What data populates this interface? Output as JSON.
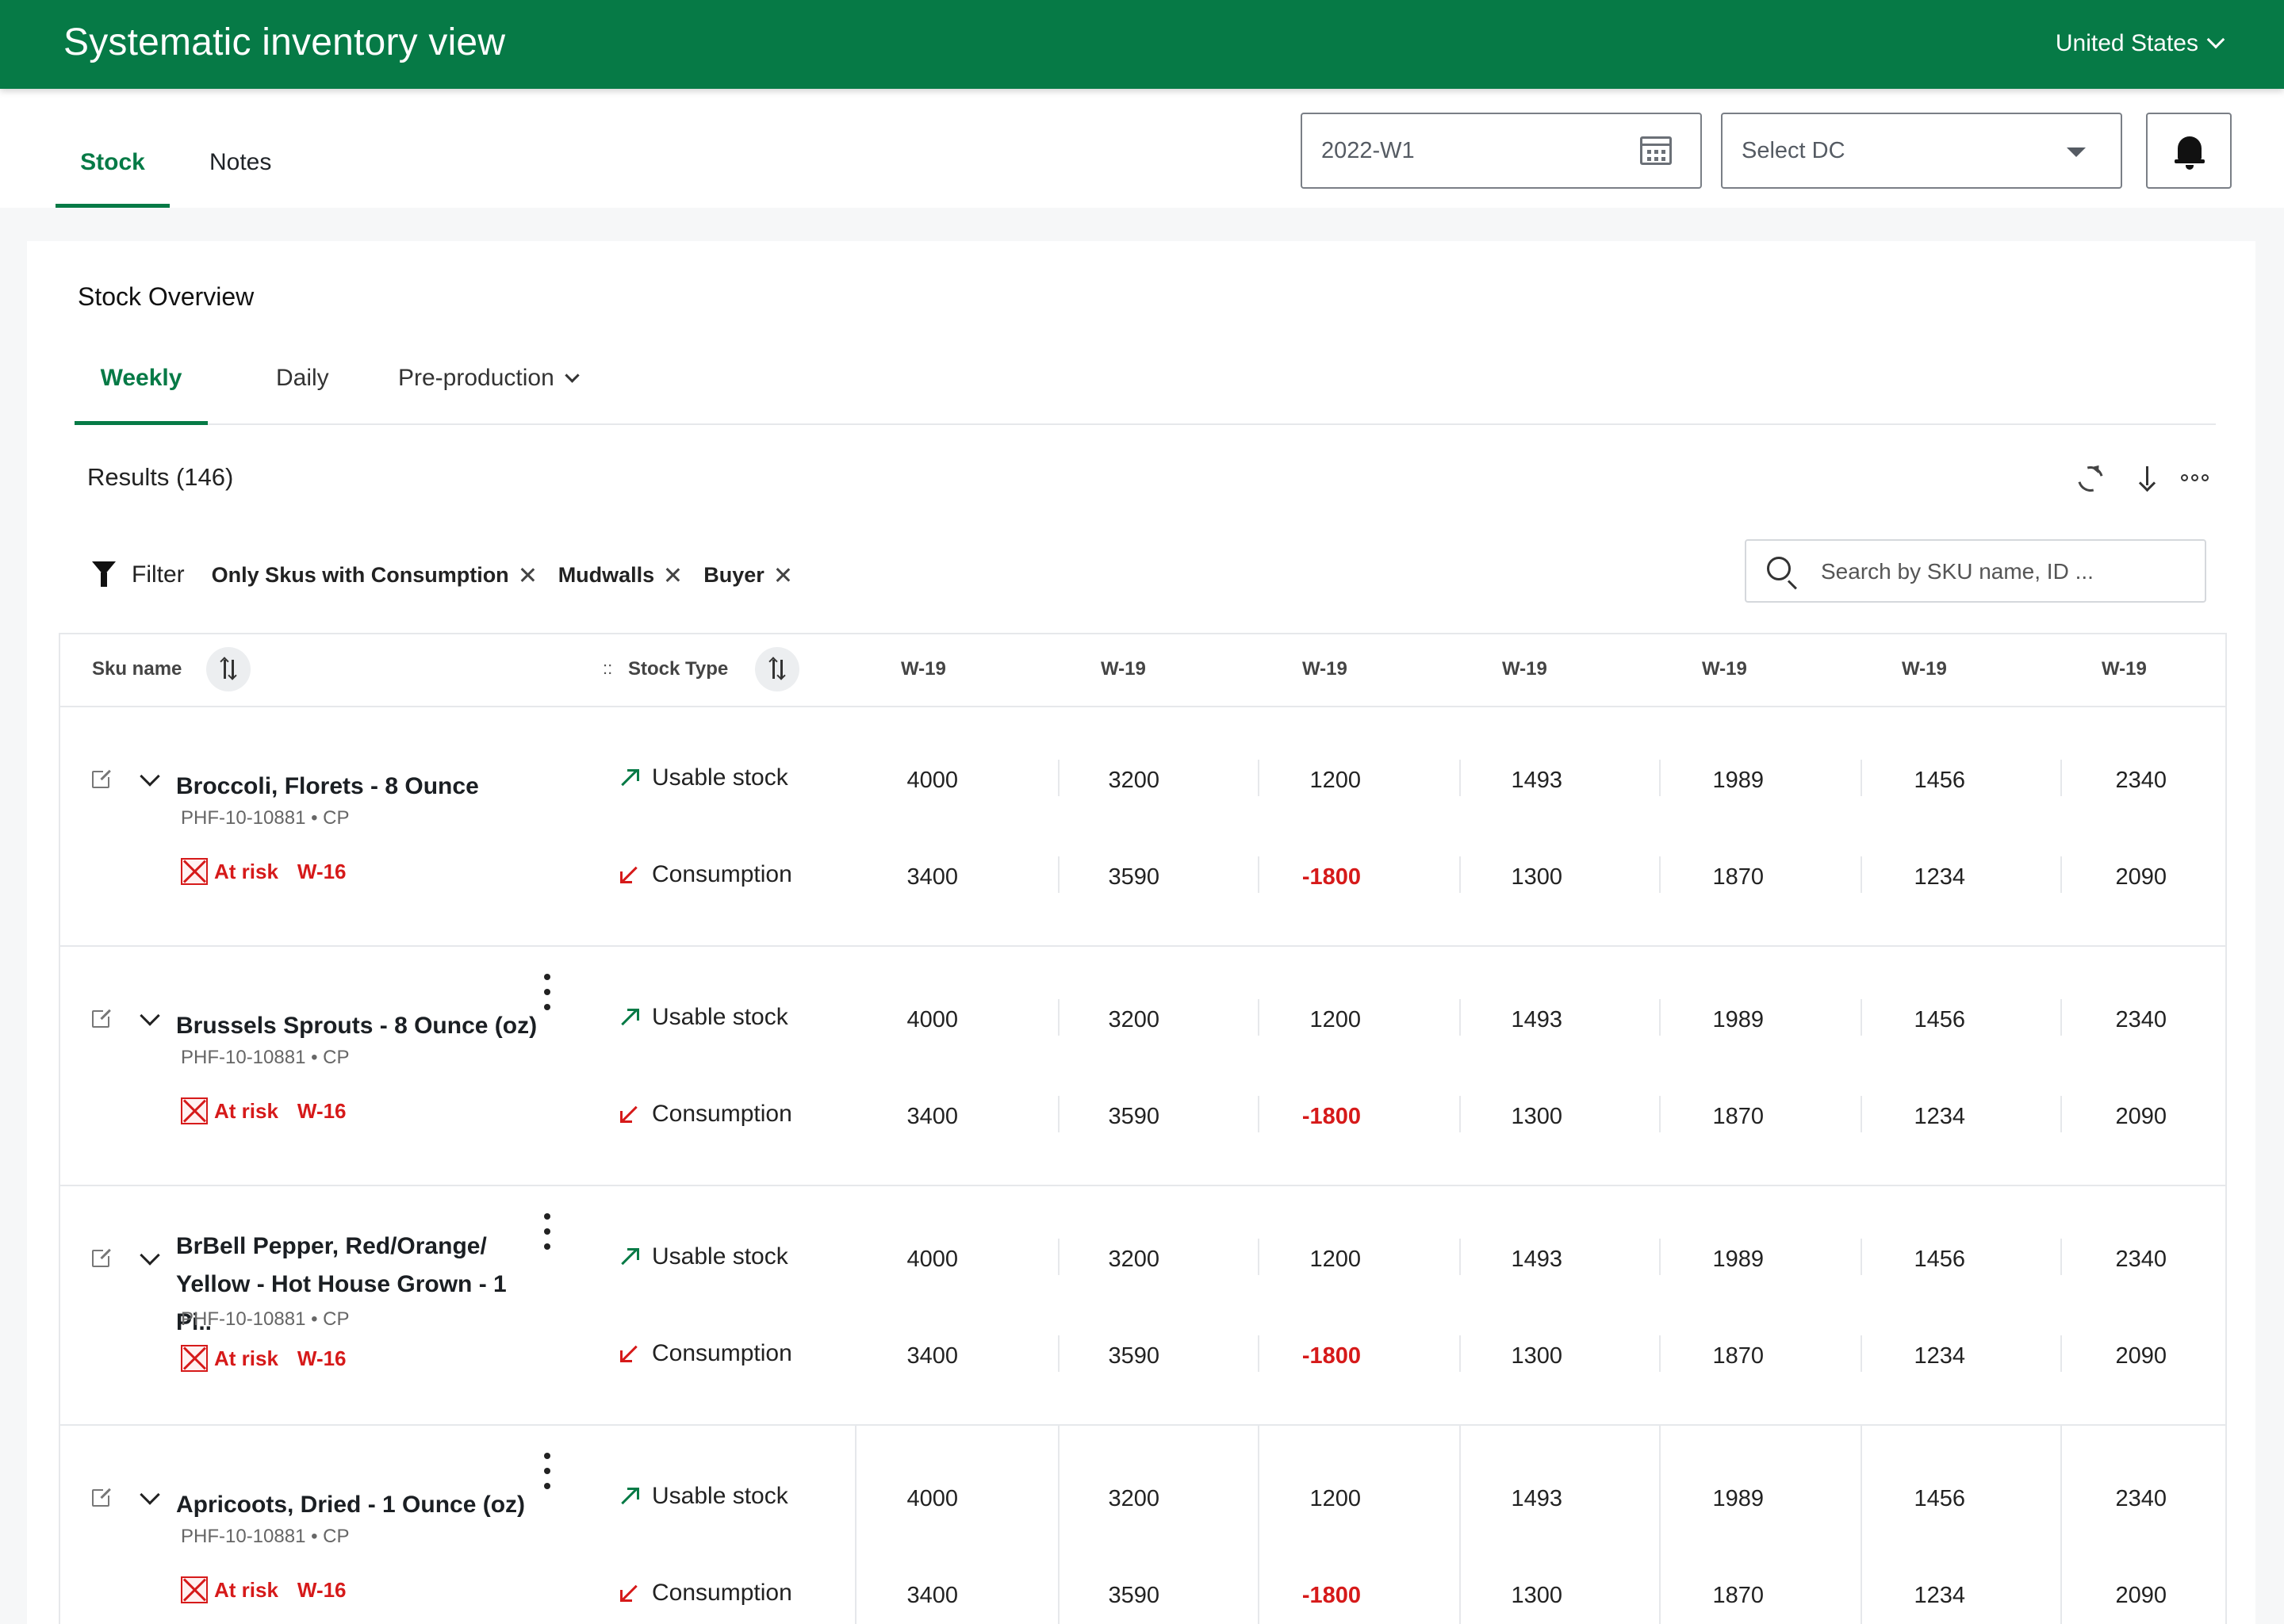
{
  "header": {
    "title": "Systematic inventory view",
    "country": "United States"
  },
  "subnav": {
    "tabs": [
      "Stock",
      "Notes"
    ],
    "active_tab": "Stock",
    "week": "2022-W1",
    "dc_placeholder": "Select DC"
  },
  "overview": {
    "title": "Stock Overview",
    "tabs": [
      "Weekly",
      "Daily",
      "Pre-production"
    ],
    "active_tab": "Weekly",
    "results_label": "Results (146)",
    "filter_label": "Filter",
    "chips": [
      "Only Skus with Consumption",
      "Mudwalls",
      "Buyer"
    ],
    "search_placeholder": "Search by SKU name, ID ..."
  },
  "table": {
    "col_sku": "Sku name",
    "col_stock_type": "Stock Type",
    "drag_handle": "::",
    "weeks": [
      "W-19",
      "W-19",
      "W-19",
      "W-19",
      "W-19",
      "W-19",
      "W-19"
    ],
    "stock_types": [
      "Usable stock",
      "Consumption"
    ],
    "rows": [
      {
        "name_lines": [
          "Broccoli, Florets - 8 Ounce",
          ""
        ],
        "id": "PHF-10-10881 • CP",
        "risk": "At risk",
        "risk_week": "W-16",
        "usable": [
          "4000",
          "3200",
          "1200",
          "1493",
          "1989",
          "1456",
          "2340"
        ],
        "consumption": [
          "3400",
          "3590",
          "-1800",
          "1300",
          "1870",
          "1234",
          "2090"
        ]
      },
      {
        "name_lines": [
          "Brussels Sprouts - 8 Ounce (oz)",
          ""
        ],
        "id": "PHF-10-10881 • CP",
        "risk": "At risk",
        "risk_week": "W-16",
        "usable": [
          "4000",
          "3200",
          "1200",
          "1493",
          "1989",
          "1456",
          "2340"
        ],
        "consumption": [
          "3400",
          "3590",
          "-1800",
          "1300",
          "1870",
          "1234",
          "2090"
        ]
      },
      {
        "name_lines": [
          "BrBell Pepper, Red/Orange/",
          "Yellow - Hot House Grown - 1 Pi.."
        ],
        "id": "PHF-10-10881 • CP",
        "risk": "At risk",
        "risk_week": "W-16",
        "usable": [
          "4000",
          "3200",
          "1200",
          "1493",
          "1989",
          "1456",
          "2340"
        ],
        "consumption": [
          "3400",
          "3590",
          "-1800",
          "1300",
          "1870",
          "1234",
          "2090"
        ]
      },
      {
        "name_lines": [
          "Apricoots, Dried - 1 Ounce (oz)",
          ""
        ],
        "id": "PHF-10-10881 • CP",
        "risk": "At risk",
        "risk_week": "W-16",
        "usable": [
          "4000",
          "3200",
          "1200",
          "1493",
          "1989",
          "1456",
          "2340"
        ],
        "consumption": [
          "3400",
          "3590",
          "-1800",
          "1300",
          "1870",
          "1234",
          "2090"
        ]
      }
    ]
  },
  "colors": {
    "brand": "#067a46",
    "danger": "#d61a1a"
  }
}
